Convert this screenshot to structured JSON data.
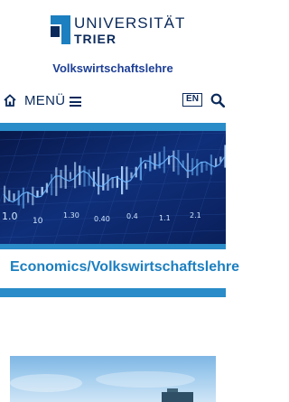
{
  "header": {
    "logo_line1": "UNIVERSITÄT",
    "logo_line2": "TRIER",
    "department": "Volkswirtschaftslehre"
  },
  "navbar": {
    "menu_label": "MENÜ",
    "language_label": "EN",
    "icons": [
      "home-icon",
      "hamburger-icon",
      "search-icon"
    ]
  },
  "banner": {
    "tickers": [
      "1.0",
      "10",
      "1.30",
      "0.40",
      "0.4",
      "1.1",
      "2.1"
    ]
  },
  "main": {
    "page_title": "Economics/Volkswirtschaftslehre"
  },
  "colors": {
    "navy": "#0b2a5b",
    "accent_blue": "#2a8cc8",
    "title_blue": "#1c7fc0",
    "department_blue": "#1d3f96"
  }
}
